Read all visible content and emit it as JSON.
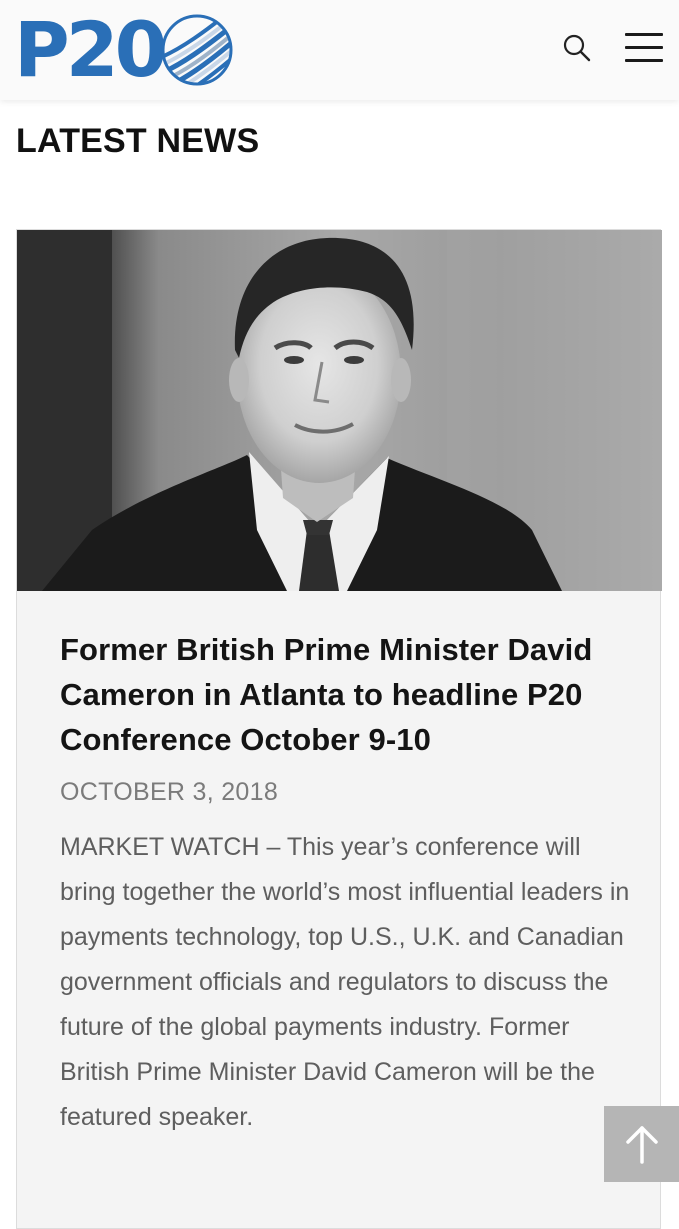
{
  "header": {
    "logo_text": "P20",
    "logo_color": "#2a6fb7",
    "search_icon": "search-icon",
    "menu_icon": "hamburger-menu-icon"
  },
  "section": {
    "title": "LATEST NEWS"
  },
  "article": {
    "image_alt": "Black and white portrait of David Cameron",
    "title": "Former British Prime Minister David Cameron in Atlanta to headline P20 Conference October 9-10",
    "date": "OCTOBER 3, 2018",
    "excerpt": "MARKET WATCH – This year’s conference will bring together the world’s most influential leaders in payments technology, top U.S., U.K. and Canadian government officials and regulators to discuss the future of the global payments industry. Former British Prime Minister David Cameron will be the featured speaker."
  },
  "back_to_top": {
    "icon": "arrow-up-icon"
  }
}
